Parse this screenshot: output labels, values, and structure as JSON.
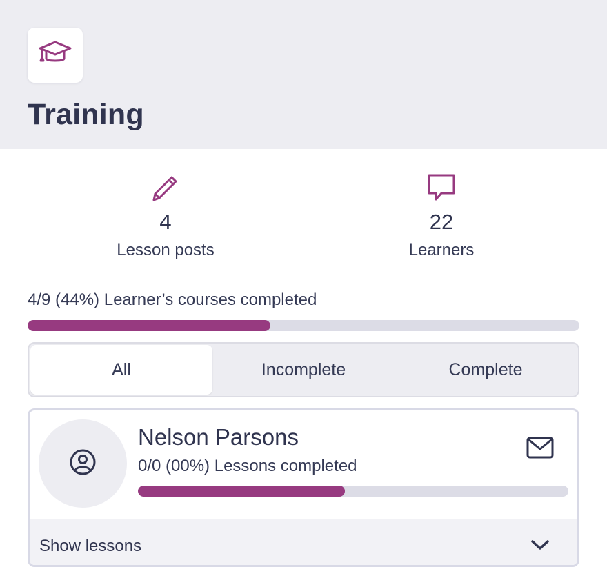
{
  "header": {
    "title": "Training",
    "icon": "graduation-cap-icon"
  },
  "stats": [
    {
      "icon": "pencil-icon",
      "value": "4",
      "label": "Lesson posts"
    },
    {
      "icon": "chat-bubble-icon",
      "value": "22",
      "label": "Learners"
    }
  ],
  "overall_progress": {
    "text": "4/9 (44%) Learner’s courses completed",
    "completed": 4,
    "total": 9,
    "percent": 44
  },
  "tabs": [
    {
      "label": "All",
      "active": true
    },
    {
      "label": "Incomplete",
      "active": false
    },
    {
      "label": "Complete",
      "active": false
    }
  ],
  "learners": [
    {
      "name": "Nelson Parsons",
      "progress_text": "0/0 (00%) Lessons completed",
      "progress_fraction": 0.48,
      "avatar_icon": "user-circle-icon",
      "action_icon": "mail-icon",
      "footer_label": "Show lessons",
      "footer_icon": "chevron-down-icon"
    }
  ],
  "colors": {
    "accent": "#973a80",
    "header_bg": "#ededf2",
    "track": "#dcdce6",
    "text_dark": "#30344f"
  }
}
